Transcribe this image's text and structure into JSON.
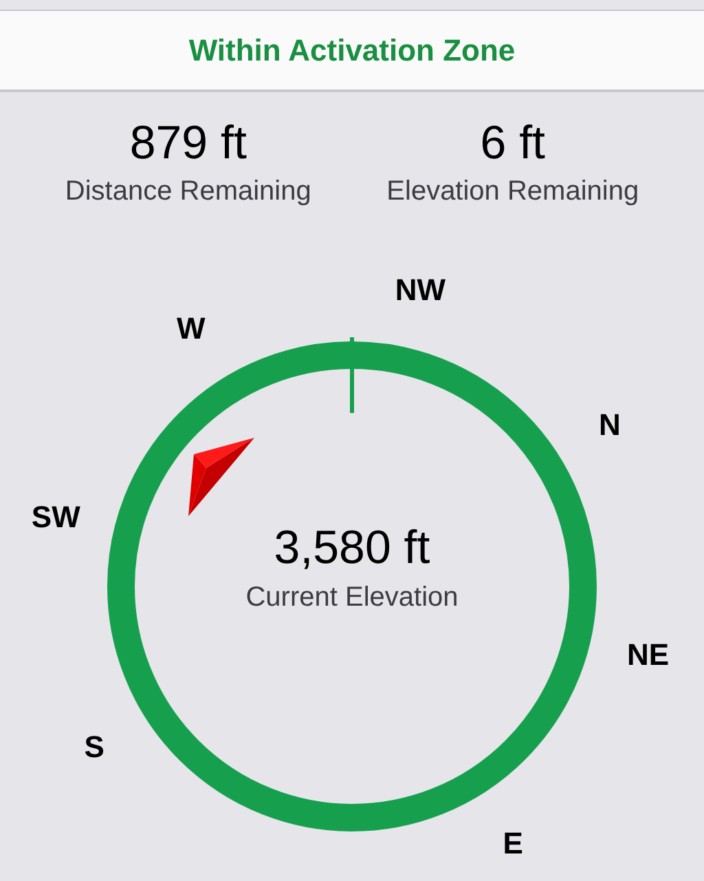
{
  "status": {
    "text": "Within Activation Zone"
  },
  "stats": [
    {
      "value": "879 ft",
      "label": "Distance Remaining"
    },
    {
      "value": "6 ft",
      "label": "Elevation Remaining"
    }
  ],
  "compass": {
    "elevation": "3,580 ft",
    "label": "Current Elevation",
    "directions": [
      {
        "label": "NW"
      },
      {
        "label": "N"
      },
      {
        "label": "NE"
      },
      {
        "label": "E"
      },
      {
        "label": "S"
      },
      {
        "label": "SW"
      },
      {
        "label": "W"
      }
    ]
  }
}
